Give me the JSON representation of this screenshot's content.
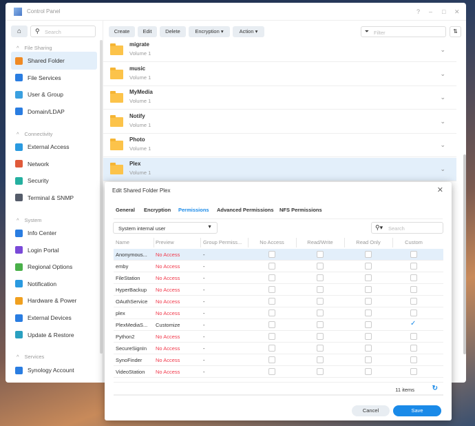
{
  "window": {
    "title": "Control Panel",
    "controls": [
      "?",
      "–",
      "□",
      "✕"
    ]
  },
  "sidebar": {
    "search_placeholder": "Search",
    "sections": [
      {
        "label": "File Sharing",
        "items": [
          {
            "label": "Shared Folder",
            "color": "#f08a24"
          },
          {
            "label": "File Services",
            "color": "#2a7de1"
          },
          {
            "label": "User & Group",
            "color": "#3aa0e0"
          },
          {
            "label": "Domain/LDAP",
            "color": "#2a7de1"
          }
        ]
      },
      {
        "label": "Connectivity",
        "items": [
          {
            "label": "External Access",
            "color": "#2a9ae0"
          },
          {
            "label": "Network",
            "color": "#e05a3a"
          },
          {
            "label": "Security",
            "color": "#25b0a0"
          },
          {
            "label": "Terminal & SNMP",
            "color": "#555c6a"
          }
        ]
      },
      {
        "label": "System",
        "items": [
          {
            "label": "Info Center",
            "color": "#2a7de1"
          },
          {
            "label": "Login Portal",
            "color": "#7a4ad8"
          },
          {
            "label": "Regional Options",
            "color": "#4ab04a"
          },
          {
            "label": "Notification",
            "color": "#2a9ae0"
          },
          {
            "label": "Hardware & Power",
            "color": "#f0a020"
          },
          {
            "label": "External Devices",
            "color": "#2a7de1"
          },
          {
            "label": "Update & Restore",
            "color": "#2aa0c0"
          }
        ]
      },
      {
        "label": "Services",
        "items": [
          {
            "label": "Synology Account",
            "color": "#2a7de1"
          }
        ]
      }
    ]
  },
  "toolbar": {
    "create": "Create",
    "edit": "Edit",
    "delete": "Delete",
    "encryption": "Encryption ▾",
    "action": "Action ▾",
    "filter_placeholder": "Filter"
  },
  "folders": [
    {
      "name": "migrate",
      "volume": "Volume 1"
    },
    {
      "name": "music",
      "volume": "Volume 1"
    },
    {
      "name": "MyMedia",
      "volume": "Volume 1"
    },
    {
      "name": "Notify",
      "volume": "Volume 1"
    },
    {
      "name": "Photo",
      "volume": "Volume 1"
    },
    {
      "name": "Plex",
      "volume": "Volume 1"
    }
  ],
  "dialog": {
    "title": "Edit Shared Folder Plex",
    "tabs": [
      "General",
      "Encryption",
      "Permissions",
      "Advanced Permissions",
      "NFS Permissions"
    ],
    "active_tab": "Permissions",
    "user_type": "System internal user",
    "search_placeholder": "Search",
    "columns": [
      "Name",
      "Preview",
      "Group Permiss...",
      "No Access",
      "Read/Write",
      "Read Only",
      "Custom"
    ],
    "rows": [
      {
        "name": "Anonymous...",
        "preview": "No Access",
        "group": "-",
        "custom": false
      },
      {
        "name": "emby",
        "preview": "No Access",
        "group": "-",
        "custom": false
      },
      {
        "name": "FileStation",
        "preview": "No Access",
        "group": "-",
        "custom": false
      },
      {
        "name": "HyperBackup",
        "preview": "No Access",
        "group": "-",
        "custom": false
      },
      {
        "name": "OAuthService",
        "preview": "No Access",
        "group": "-",
        "custom": false
      },
      {
        "name": "plex",
        "preview": "No Access",
        "group": "-",
        "custom": false
      },
      {
        "name": "PlexMediaS...",
        "preview": "Customize",
        "group": "-",
        "custom": true
      },
      {
        "name": "Python2",
        "preview": "No Access",
        "group": "-",
        "custom": false
      },
      {
        "name": "SecureSignIn",
        "preview": "No Access",
        "group": "-",
        "custom": false
      },
      {
        "name": "SynoFinder",
        "preview": "No Access",
        "group": "-",
        "custom": false
      },
      {
        "name": "VideoStation",
        "preview": "No Access",
        "group": "-",
        "custom": false
      }
    ],
    "item_count": "11 items",
    "cancel": "Cancel",
    "save": "Save"
  }
}
